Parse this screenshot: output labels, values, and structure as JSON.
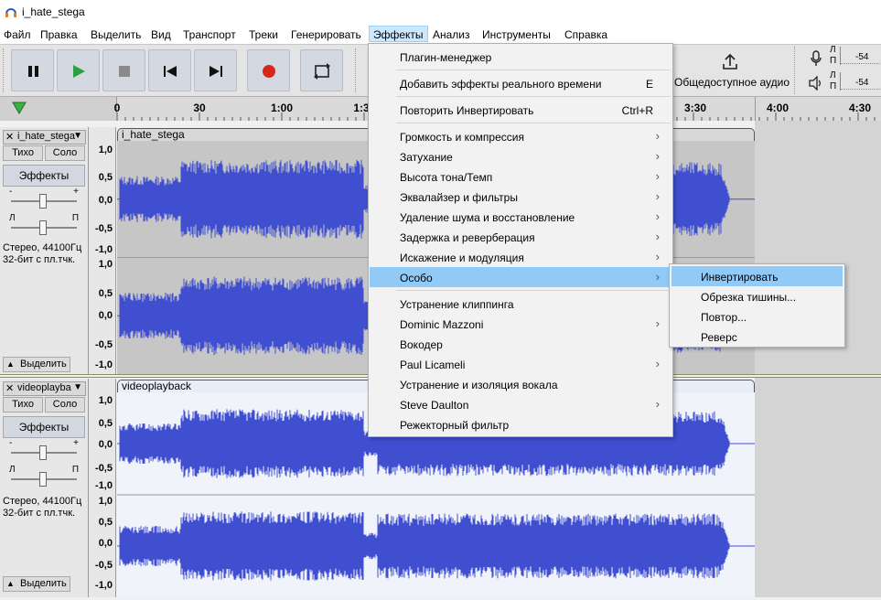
{
  "window": {
    "title": "i_hate_stega"
  },
  "menubar": {
    "items": [
      {
        "label": "Файл"
      },
      {
        "label": "Правка"
      },
      {
        "label": "Выделить"
      },
      {
        "label": "Вид"
      },
      {
        "label": "Транспорт"
      },
      {
        "label": "Треки"
      },
      {
        "label": "Генерировать"
      },
      {
        "label": "Эффекты",
        "active": true
      },
      {
        "label": "Анализ"
      },
      {
        "label": "Инструменты"
      },
      {
        "label": "Справка"
      }
    ]
  },
  "toolbar": {
    "buttons": [
      {
        "name": "pause-button",
        "icon": "pause-icon"
      },
      {
        "name": "play-button",
        "icon": "play-icon"
      },
      {
        "name": "stop-button",
        "icon": "stop-icon"
      },
      {
        "name": "skip-start-button",
        "icon": "skip-start-icon"
      },
      {
        "name": "skip-end-button",
        "icon": "skip-end-icon"
      },
      {
        "name": "record-button",
        "icon": "record-icon"
      },
      {
        "name": "loop-button",
        "icon": "loop-icon"
      }
    ],
    "share_label": "Общедоступное аудио",
    "meter_letters": [
      "Л",
      "П",
      "Л",
      "П"
    ],
    "meter_value": "-54"
  },
  "timeline": {
    "ticks": [
      "0",
      "30",
      "1:00",
      "1:3",
      "3:30",
      "4:00",
      "4:30"
    ]
  },
  "tracks": [
    {
      "name": "i_hate_stega",
      "clip_name": "i_hate_stega",
      "mute_label": "Тихо",
      "solo_label": "Соло",
      "effects_label": "Эффекты",
      "gain_minus": "-",
      "gain_plus": "+",
      "pan_left": "Л",
      "pan_right": "П",
      "info_line1": "Стерео, 44100Гц",
      "info_line2": "32-бит с пл.тчк.",
      "select_label": "Выделить",
      "scale": [
        "1,0",
        "0,5",
        "0,0",
        "-0,5",
        "-1,0"
      ],
      "selected": true
    },
    {
      "name": "videoplayba",
      "clip_name": "videoplayback",
      "mute_label": "Тихо",
      "solo_label": "Соло",
      "effects_label": "Эффекты",
      "gain_minus": "-",
      "gain_plus": "+",
      "pan_left": "Л",
      "pan_right": "П",
      "info_line1": "Стерео, 44100Гц",
      "info_line2": "32-бит с пл.тчк.",
      "select_label": "Выделить",
      "scale": [
        "1,0",
        "0,5",
        "0,0",
        "-0,5",
        "-1,0"
      ],
      "selected": false
    }
  ],
  "effects_menu": {
    "items": [
      {
        "label": "Плагин-менеджер",
        "type": "item"
      },
      {
        "type": "sep"
      },
      {
        "label": "Добавить эффекты реального времени",
        "shortcut": "E",
        "type": "item"
      },
      {
        "type": "sep"
      },
      {
        "label": "Повторить Инвертировать",
        "shortcut": "Ctrl+R",
        "type": "item"
      },
      {
        "type": "sep"
      },
      {
        "label": "Громкость и компрессия",
        "submenu": true,
        "type": "item"
      },
      {
        "label": "Затухание",
        "submenu": true,
        "type": "item"
      },
      {
        "label": "Высота тона/Темп",
        "submenu": true,
        "type": "item"
      },
      {
        "label": "Эквалайзер и фильтры",
        "submenu": true,
        "type": "item"
      },
      {
        "label": "Удаление шума и восстановление",
        "submenu": true,
        "type": "item"
      },
      {
        "label": "Задержка и реверберация",
        "submenu": true,
        "type": "item"
      },
      {
        "label": "Искажение и модуляция",
        "submenu": true,
        "type": "item"
      },
      {
        "label": "Особо",
        "submenu": true,
        "type": "item",
        "highlighted": true
      },
      {
        "type": "sep"
      },
      {
        "label": "Устранение клиппинга",
        "type": "item"
      },
      {
        "label": "Dominic Mazzoni",
        "submenu": true,
        "type": "item"
      },
      {
        "label": "Вокодер",
        "type": "item"
      },
      {
        "label": "Paul Licameli",
        "submenu": true,
        "type": "item"
      },
      {
        "label": "Устранение и изоляция вокала",
        "type": "item"
      },
      {
        "label": "Steve Daulton",
        "submenu": true,
        "type": "item"
      },
      {
        "label": "Режекторный фильтр",
        "type": "item"
      }
    ]
  },
  "special_submenu": {
    "items": [
      {
        "label": "Инвертировать",
        "highlighted": true
      },
      {
        "label": "Обрезка тишины..."
      },
      {
        "label": "Повтор..."
      },
      {
        "label": "Реверс"
      }
    ]
  },
  "colors": {
    "waveform": "#3f4fd0",
    "selected_bg": "#c6c6c6",
    "unselected_bg": "#f0f3fa",
    "menu_highlight": "#91c9f7",
    "record_red": "#d9261c",
    "play_green": "#2ea043"
  }
}
